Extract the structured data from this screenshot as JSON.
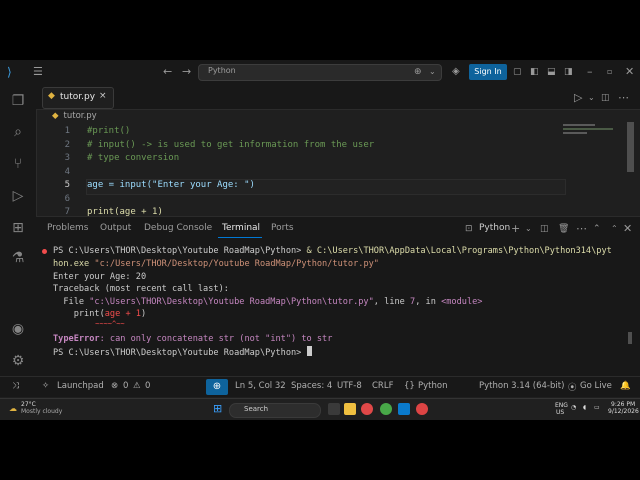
{
  "titlebar": {
    "command_center": "Python",
    "signin_label": "Sign In"
  },
  "tab": {
    "label": "tutor.py",
    "close": "×"
  },
  "breadcrumb": "tutor.py",
  "editor": {
    "lines": [
      {
        "num": "1",
        "text": "#print()"
      },
      {
        "num": "2",
        "text": "# input() -> is used to get information from the user"
      },
      {
        "num": "3",
        "text": "# type conversion"
      },
      {
        "num": "4",
        "text": ""
      },
      {
        "num": "5",
        "text": "age = input(\"Enter your Age: \")"
      },
      {
        "num": "6",
        "text": ""
      },
      {
        "num": "7",
        "text": "print(age + 1)"
      }
    ]
  },
  "panel": {
    "tabs": [
      "Problems",
      "Output",
      "Debug Console",
      "Terminal",
      "Ports"
    ],
    "active_tab": "Terminal",
    "shell_label": "Python",
    "terminal": {
      "prompt1": "PS C:\\Users\\THOR\\Desktop\\Youtube RoadMap\\Python> ",
      "cmd_amp": "& ",
      "cmd_exe_a": "C:\\Users\\THOR\\AppData\\Local\\Programs\\Python\\Python314\\pyt",
      "cmd_exe_b": "hon.exe",
      "cmd_arg": "\"c:/Users/THOR/Desktop/Youtube RoadMap/Python/tutor.py\"",
      "enter_age": "Enter your Age: 20",
      "traceback": "Traceback (most recent call last):",
      "file_prefix": "  File ",
      "file_path": "\"c:\\Users\\THOR\\Desktop\\Youtube RoadMap\\Python\\tutor.py\"",
      "file_mid": ", line ",
      "file_line": "7",
      "file_in": ", in ",
      "file_module": "<module>",
      "code_a": "    print(",
      "code_b": "age + 1",
      "code_c": ")",
      "carets": "          ~~~~^~~",
      "error_name": "TypeError",
      "error_msg": ": can only concatenate str (not \"int\") to str",
      "prompt2": "PS C:\\Users\\THOR\\Desktop\\Youtube RoadMap\\Python> "
    }
  },
  "statusbar": {
    "launchpad": "Launchpad",
    "errors": "0",
    "warnings": "0",
    "position": "Ln 5, Col 32",
    "spaces": "Spaces: 4",
    "encoding": "UTF-8",
    "eol": "CRLF",
    "language": "Python",
    "interpreter": "Python 3.14 (64-bit)",
    "golive": "Go Live"
  },
  "taskbar": {
    "weather_temp": "27°C",
    "weather_desc": "Mostly cloudy",
    "search_label": "Search",
    "lang_top": "ENG",
    "lang_bottom": "US",
    "time": "9:26 PM",
    "date": "9/12/2026"
  },
  "colors": {
    "accent": "#0078d4",
    "signin": "#0e639c",
    "editor_bg": "#1f1f1f",
    "error_red": "#f14c4c"
  },
  "icons": [
    "vscode-logo-icon",
    "menu-icon",
    "back-icon",
    "forward-icon",
    "copilot-icon",
    "layout-icon",
    "minimize-icon",
    "maximize-icon",
    "close-icon",
    "explorer-icon",
    "search-icon",
    "source-control-icon",
    "run-debug-icon",
    "extensions-icon",
    "testing-icon",
    "account-icon",
    "settings-icon",
    "python-file-icon",
    "run-icon",
    "split-editor-icon",
    "more-icon",
    "terminal-icon",
    "add-terminal-icon",
    "trash-icon",
    "panel-maximize-icon",
    "bell-icon",
    "windows-start-icon"
  ]
}
